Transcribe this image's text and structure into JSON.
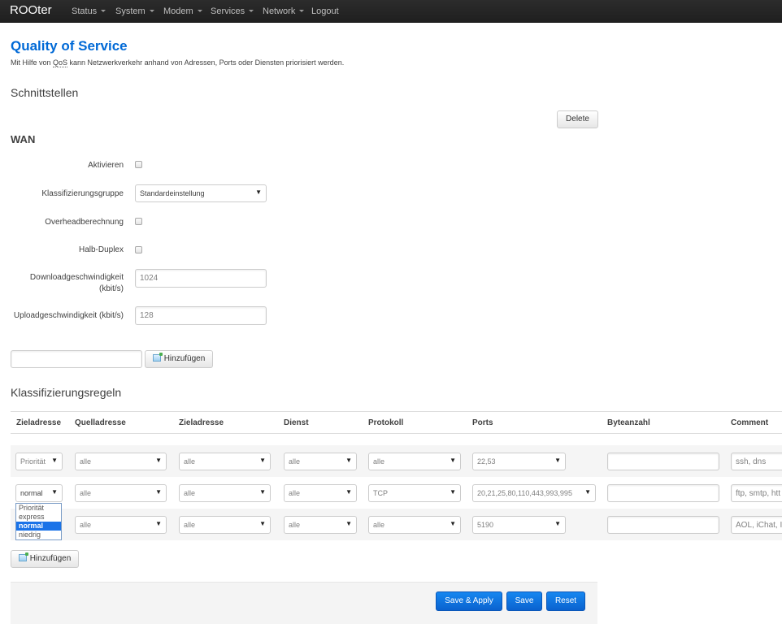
{
  "nav": {
    "brand": "ROOter",
    "items": [
      "Status",
      "System",
      "Modem",
      "Services",
      "Network"
    ],
    "logout": "Logout"
  },
  "page": {
    "title": "Quality of Service",
    "desc_prefix": "Mit Hilfe von ",
    "desc_abbr": "QoS",
    "desc_suffix": " kann Netzwerkverkehr anhand von Adressen, Ports oder Diensten priorisiert werden."
  },
  "interfaces": {
    "title": "Schnittstellen",
    "delete_label": "Delete",
    "name": "WAN",
    "fields": {
      "enable_label": "Aktivieren",
      "classgroup_label": "Klassifizierungsgruppe",
      "classgroup_value": "Standardeinstellung",
      "overhead_label": "Overheadberechnung",
      "halfduplex_label": "Halb-Duplex",
      "download_label_1": "Downloadgeschwindigkeit",
      "download_label_2": "(kbit/s)",
      "download_value": "1024",
      "upload_label": "Uploadgeschwindigkeit (kbit/s)",
      "upload_value": "128"
    },
    "add_value": "",
    "add_label": "Hinzufügen"
  },
  "rules": {
    "title": "Klassifizierungsregeln",
    "columns": [
      "Zieladresse",
      "Quelladresse",
      "Zieladresse",
      "Dienst",
      "Protokoll",
      "Ports",
      "Byteanzahl",
      "Comment"
    ],
    "rows": [
      {
        "target": "Priorität",
        "src": "alle",
        "dst": "alle",
        "service": "alle",
        "proto": "alle",
        "ports": "22,53",
        "bytes": "",
        "comment": "ssh, dns"
      },
      {
        "target": "normal",
        "src": "alle",
        "dst": "alle",
        "service": "alle",
        "proto": "TCP",
        "ports": "20,21,25,80,110,443,993,995",
        "bytes": "",
        "comment": "ftp, smtp, htt"
      },
      {
        "target": "",
        "src": "alle",
        "dst": "alle",
        "service": "alle",
        "proto": "alle",
        "ports": "5190",
        "bytes": "",
        "comment": "AOL, iChat, I"
      }
    ],
    "dropdown_options": [
      "Priorität",
      "express",
      "normal",
      "niedrig"
    ],
    "dropdown_selected": "normal",
    "add_label": "Hinzufügen"
  },
  "footer": {
    "save_apply": "Save & Apply",
    "save": "Save",
    "reset": "Reset"
  },
  "colors": {
    "title_blue": "#0069d6",
    "primary_button": "#0a62cf",
    "navbar": "#222222"
  },
  "icons": {
    "add": "add-icon",
    "caret": "chevron-down-icon"
  }
}
